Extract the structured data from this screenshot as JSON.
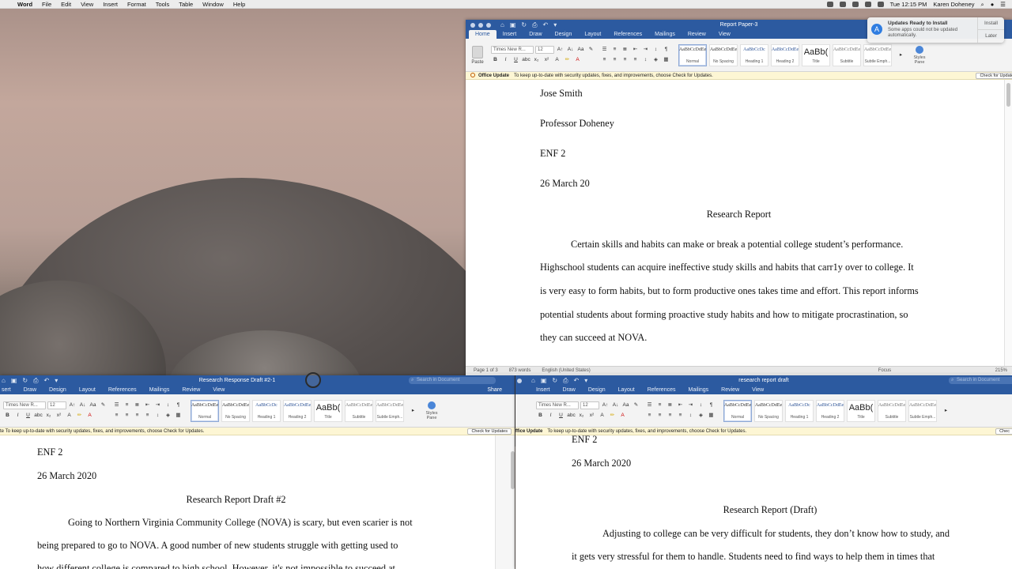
{
  "menubar": {
    "app": "Word",
    "items": [
      "File",
      "Edit",
      "View",
      "Insert",
      "Format",
      "Tools",
      "Table",
      "Window",
      "Help"
    ],
    "clock": "Tue 12:15 PM",
    "user": "Karen Doheney"
  },
  "notification": {
    "title": "Updates Ready to Install",
    "body": "Some apps could not be updated automatically.",
    "install": "Install",
    "later": "Later"
  },
  "ribbon": {
    "tabs": [
      "Home",
      "Insert",
      "Draw",
      "Design",
      "Layout",
      "References",
      "Mailings",
      "Review",
      "View"
    ],
    "tabs_bottom_left": [
      "sert",
      "Draw",
      "Design",
      "Layout",
      "References",
      "Mailings",
      "Review",
      "View"
    ],
    "font": "Times New R...",
    "size": "12",
    "paste": "Paste",
    "styles": [
      {
        "sample": "AaBbCcDdEe",
        "name": "Normal"
      },
      {
        "sample": "AaBbCcDdEe",
        "name": "No Spacing"
      },
      {
        "sample": "AaBbCcDc",
        "name": "Heading 1"
      },
      {
        "sample": "AaBbCcDdEe",
        "name": "Heading 2"
      },
      {
        "sample": "AaBb(",
        "name": "Title"
      },
      {
        "sample": "AaBbCcDdEe",
        "name": "Subtitle"
      },
      {
        "sample": "AaBbCcDdEe",
        "name": "Subtle Emph..."
      }
    ],
    "styles_pane": "Styles Pane",
    "share": "Share",
    "search_placeholder": "Search in Document"
  },
  "message_bar": {
    "label": "Office Update",
    "label_short": "ffice Update",
    "text": "To keep up-to-date with security updates, fixes, and improvements, choose Check for Updates.",
    "text_short": "te  To keep up-to-date with security updates, fixes, and improvements, choose Check for Updates.",
    "button": "Check for Updates",
    "button_clip": "Chec"
  },
  "win_top": {
    "title": "Report Paper-3",
    "lines": [
      "Jose Smith",
      "Professor Doheney",
      "ENF 2",
      "26 March 20",
      "Research Report"
    ],
    "paragraph": [
      "Certain skills and habits can make or break a potential college student’s performance.",
      "Highschool students can acquire ineffective study skills and habits that carr1y over to college. It",
      "is very easy to form habits, but to form productive ones takes time and effort. This report informs",
      "potential students about forming proactive study habits and how to mitigate procrastination, so",
      "they can succeed at NOVA."
    ],
    "status": {
      "page": "Page 1 of 3",
      "words": "873 words",
      "lang": "English (United States)",
      "focus": "Focus",
      "zoom": "215%"
    }
  },
  "win_left": {
    "title": "Research Response Draft #2-1",
    "lines": [
      "ENF 2",
      "26 March 2020",
      "Research Report Draft #2"
    ],
    "paragraph": [
      "Going to Northern Virginia Community College (NOVA) is scary, but even scarier is not",
      "being prepared to go to NOVA. A good number of new students struggle with getting used to",
      "how different college is compared to high school. However, it's not impossible to succeed at"
    ]
  },
  "win_right": {
    "title": "research report draft",
    "lines": [
      "ENF 2",
      "26 March 2020",
      "Research Report (Draft)"
    ],
    "paragraph": [
      "Adjusting to college can be very difficult for students, they don’t know how to study, and",
      "it gets very stressful for them to handle. Students need to find ways to help them in times that"
    ]
  },
  "colors": {
    "word_blue": "#2c5aa0",
    "ribbon": "#f3f3f3",
    "message": "#fdf6d4"
  }
}
